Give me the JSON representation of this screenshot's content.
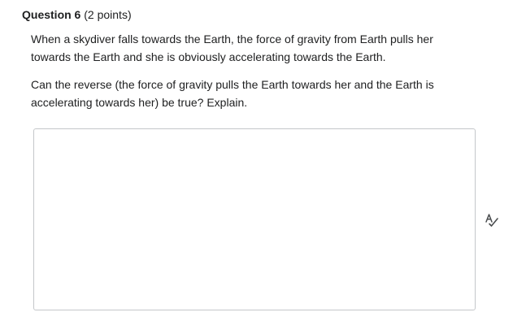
{
  "question": {
    "title": "Question 6",
    "points": "(2 points)",
    "paragraph_1": "When a skydiver falls towards the Earth, the force of gravity from Earth pulls her towards the Earth and she is obviously accelerating towards the Earth.",
    "paragraph_2": "Can the reverse (the force of gravity pulls the Earth towards her and the Earth is accelerating towards her) be true? Explain."
  },
  "answer": {
    "value": "",
    "placeholder": ""
  },
  "icons": {
    "spellcheck": "spellcheck-icon"
  },
  "colors": {
    "text": "#202122",
    "border": "#c4c7ca",
    "icon": "#494c4e"
  }
}
